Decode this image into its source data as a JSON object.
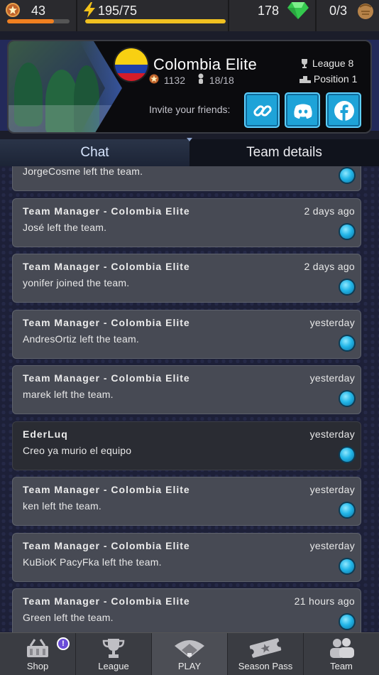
{
  "status": {
    "level": "43",
    "energy": "195/75",
    "gems": "178",
    "gloves": "0/3",
    "level_progress": 0.75,
    "energy_progress": 1.0
  },
  "team": {
    "name": "Colombia Elite",
    "rating": "1132",
    "members": "18/18",
    "league": "League 8",
    "position": "Position 1",
    "invite_label": "Invite your friends:"
  },
  "social": [
    "link-icon",
    "discord-icon",
    "facebook-icon"
  ],
  "tabs": {
    "chat": "Chat",
    "details": "Team details",
    "active": "chat"
  },
  "messages": [
    {
      "author": "",
      "time": "",
      "text": "JorgeCosme left the team.",
      "type": "system"
    },
    {
      "author": "Team Manager - Colombia Elite",
      "time": "2 days ago",
      "text": "José  left the team.",
      "type": "system"
    },
    {
      "author": "Team Manager - Colombia Elite",
      "time": "2 days ago",
      "text": "yonifer  joined the team.",
      "type": "system"
    },
    {
      "author": "Team Manager - Colombia Elite",
      "time": "yesterday",
      "text": "AndresOrtiz left the team.",
      "type": "system"
    },
    {
      "author": "Team Manager - Colombia Elite",
      "time": "yesterday",
      "text": "marek left the team.",
      "type": "system"
    },
    {
      "author": "EderLuq",
      "time": "yesterday",
      "text": "Creo ya murio el equipo",
      "type": "user"
    },
    {
      "author": "Team Manager - Colombia Elite",
      "time": "yesterday",
      "text": "ken  left the team.",
      "type": "system"
    },
    {
      "author": "Team Manager - Colombia Elite",
      "time": "yesterday",
      "text": "KuBioK PacyFka left the team.",
      "type": "system"
    },
    {
      "author": "Team Manager - Colombia Elite",
      "time": "21 hours ago",
      "text": "Green left the team.",
      "type": "system"
    }
  ],
  "nav": {
    "shop": "Shop",
    "league": "League",
    "play": "PLAY",
    "season": "Season Pass",
    "team": "Team",
    "shop_badge": "!",
    "active": "play"
  },
  "colors": {
    "accent": "#1ea3d8",
    "energy": "#f0c020",
    "level_bar": "#f08020",
    "gem": "#38d858"
  }
}
